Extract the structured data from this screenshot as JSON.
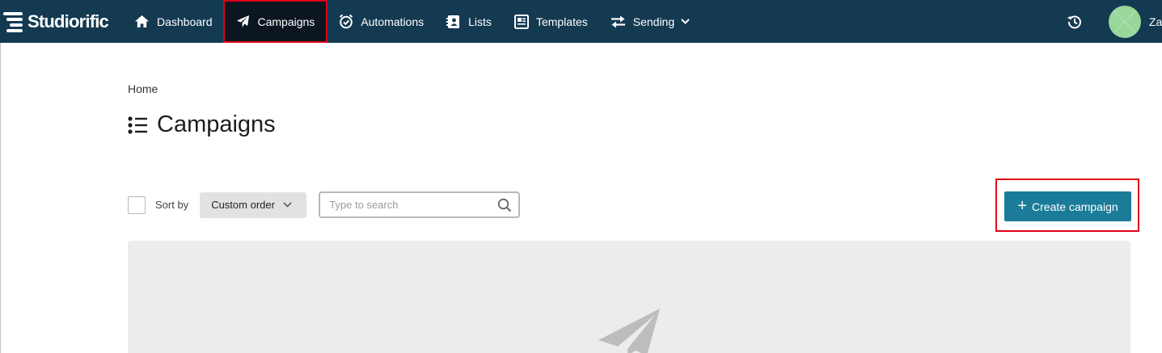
{
  "navbar": {
    "brand": "Studiorific",
    "items": [
      {
        "label": "Dashboard",
        "icon": "home-icon"
      },
      {
        "label": "Campaigns",
        "icon": "paper-plane-icon",
        "active": true
      },
      {
        "label": "Automations",
        "icon": "alarm-clock-icon"
      },
      {
        "label": "Lists",
        "icon": "address-book-icon"
      },
      {
        "label": "Templates",
        "icon": "newspaper-icon"
      },
      {
        "label": "Sending",
        "icon": "exchange-arrows-icon",
        "has_dropdown": true
      }
    ],
    "user_name": "Za"
  },
  "breadcrumb": "Home",
  "page": {
    "title": "Campaigns",
    "title_icon": "list-icon"
  },
  "toolbar": {
    "sort_label": "Sort by",
    "sort_value": "Custom order",
    "search_placeholder": "Type to search"
  },
  "create_button": {
    "label": "Create campaign"
  },
  "colors": {
    "navbar": "#143a52",
    "active_nav": "#0b1620",
    "primary_button": "#1a7c99",
    "highlight_border": "#e0001b",
    "avatar": "#98d69a",
    "empty_panel": "#ececec"
  }
}
